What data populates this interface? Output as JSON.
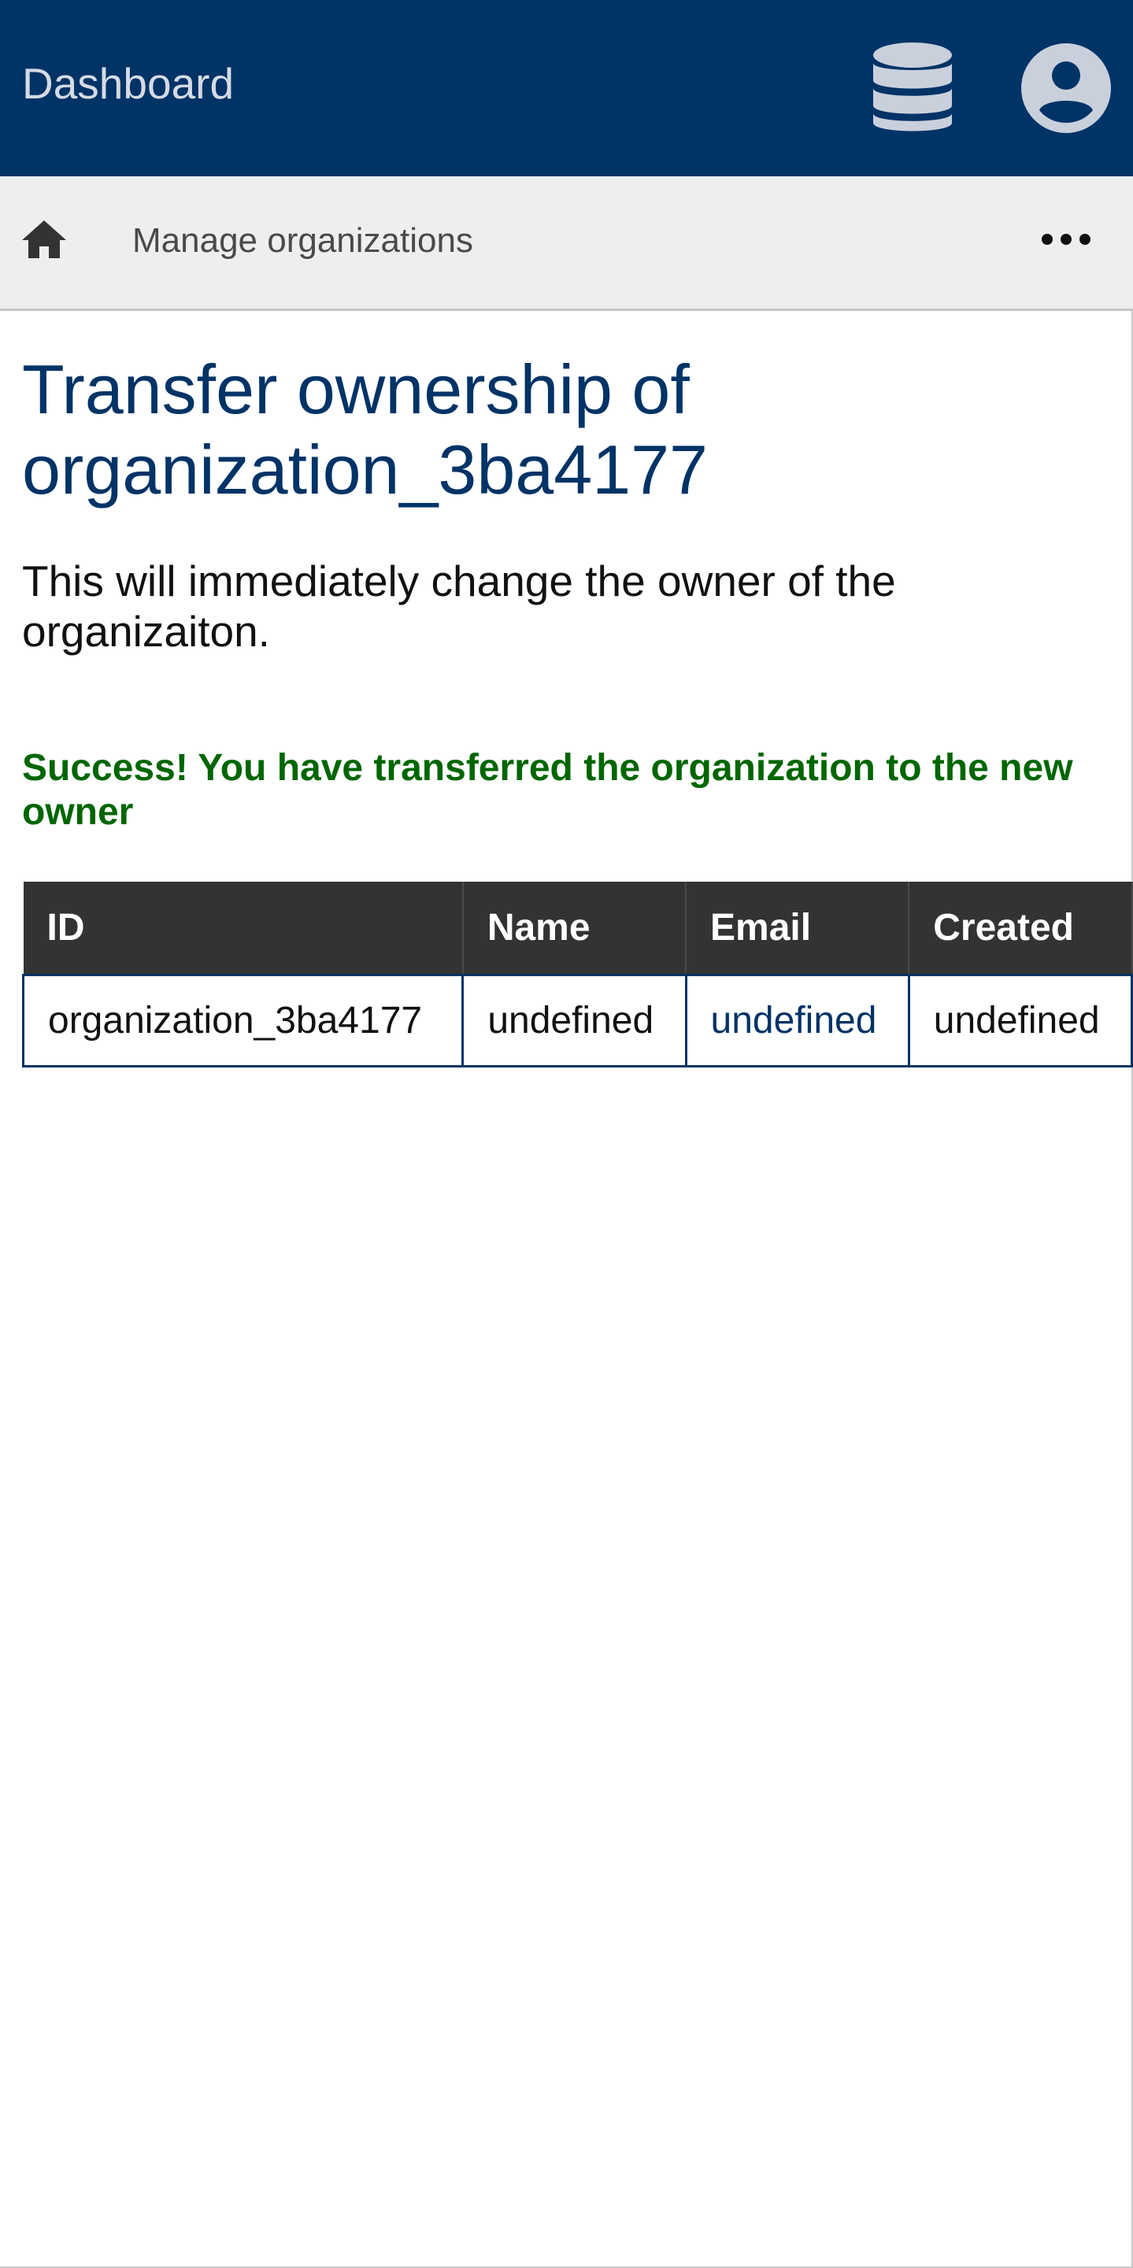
{
  "header": {
    "brand": "Dashboard",
    "database_icon": "database-icon",
    "account_icon": "account-circle-icon"
  },
  "breadcrumb": {
    "home_icon": "home-icon",
    "current": "Manage organizations",
    "more_icon": "more-horizontal-icon"
  },
  "main": {
    "title": "Transfer ownership of organization_3ba4177",
    "description": "This will immediately change the owner of the organizaiton.",
    "success": "Success! You have transferred the organization to the new owner"
  },
  "table": {
    "headers": [
      "ID",
      "Name",
      "Email",
      "Created"
    ],
    "rows": [
      {
        "id": "organization_3ba4177",
        "name": "undefined",
        "email": "undefined",
        "created": "undefined"
      }
    ]
  },
  "colors": {
    "header_bg": "#003366",
    "breadcrumb_bg": "#eeeeee",
    "title": "#003366",
    "success": "#006600",
    "table_header_bg": "#333333",
    "table_border": "#003366"
  }
}
